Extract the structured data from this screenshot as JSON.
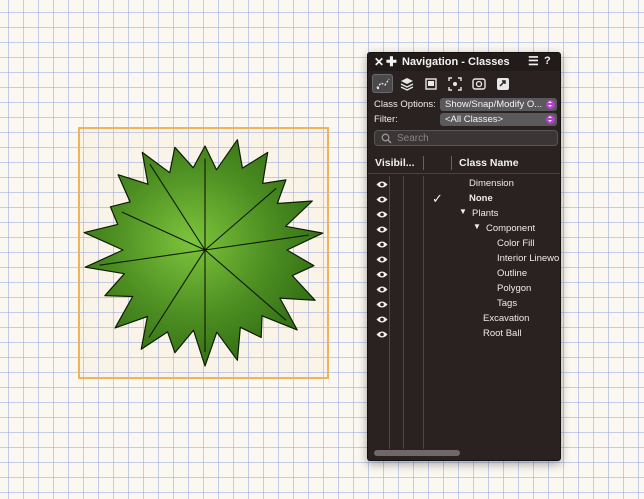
{
  "palette": {
    "title": "Navigation - Classes",
    "close_glyph": "✕",
    "add_glyph": "✚",
    "menu_glyph": "☰",
    "help_glyph": "?",
    "toolbar": [
      {
        "name": "classes-tab",
        "icon": "classes-icon",
        "active": true
      },
      {
        "name": "layers-tab",
        "icon": "layers-icon",
        "active": false
      },
      {
        "name": "sheet-layers-tab",
        "icon": "sheet-layers-icon",
        "active": false
      },
      {
        "name": "viewports-tab",
        "icon": "viewports-icon",
        "active": false
      },
      {
        "name": "saved-views-tab",
        "icon": "saved-views-icon",
        "active": false
      },
      {
        "name": "references-tab",
        "icon": "references-icon",
        "active": false
      }
    ],
    "class_options_label": "Class Options:",
    "class_options_value": "Show/Snap/Modify O...",
    "filter_label": "Filter:",
    "filter_value": "<All Classes>",
    "search_placeholder": "Search",
    "col_visibility": "Visibil...",
    "col_class_name": "Class Name",
    "check_glyph": "✓",
    "expand_glyph": "▼",
    "rows": [
      {
        "name": "Dimension",
        "level": 0,
        "expanded": false,
        "bold": false,
        "active": false
      },
      {
        "name": "None",
        "level": 0,
        "expanded": false,
        "bold": true,
        "active": true
      },
      {
        "name": "Plants",
        "level": 0,
        "expanded": true,
        "bold": false,
        "active": false
      },
      {
        "name": "Component",
        "level": 1,
        "expanded": true,
        "bold": false,
        "active": false
      },
      {
        "name": "Color Fill",
        "level": 2,
        "expanded": false,
        "bold": false,
        "active": false
      },
      {
        "name": "Interior Linewo",
        "level": 2,
        "expanded": false,
        "bold": false,
        "active": false
      },
      {
        "name": "Outline",
        "level": 2,
        "expanded": false,
        "bold": false,
        "active": false
      },
      {
        "name": "Polygon",
        "level": 2,
        "expanded": false,
        "bold": false,
        "active": false
      },
      {
        "name": "Tags",
        "level": 2,
        "expanded": false,
        "bold": false,
        "active": false
      },
      {
        "name": "Excavation",
        "level": 1,
        "expanded": false,
        "bold": false,
        "active": false
      },
      {
        "name": "Root Ball",
        "level": 1,
        "expanded": false,
        "bold": false,
        "active": false
      }
    ]
  },
  "canvas": {
    "selection_color": "#f0b25a",
    "leaf_color_light": "#7dc43c",
    "leaf_color_dark": "#2f6a12",
    "grid_color": "#96aae1"
  }
}
